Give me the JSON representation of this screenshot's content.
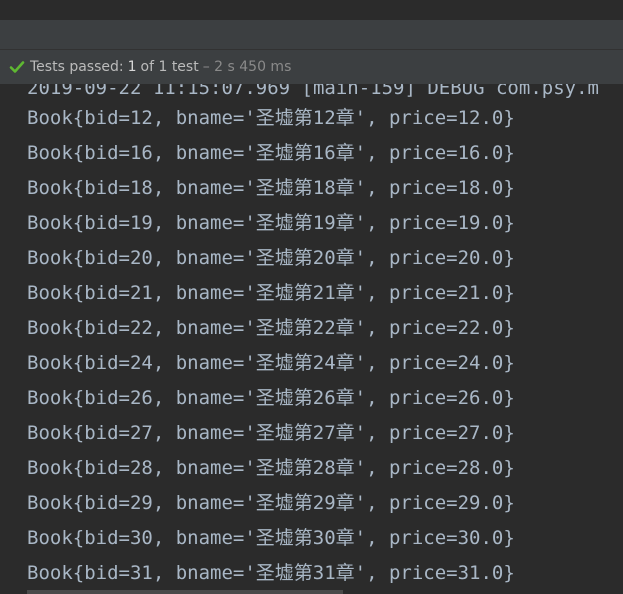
{
  "status": {
    "label": "Tests passed:",
    "passed": "1",
    "of_text": "of 1 test",
    "duration": "– 2 s 450 ms",
    "icon": "check-icon",
    "icon_color": "#5fb832"
  },
  "console": {
    "lines": [
      "2019-09-22 11:15:07.969 [main-159] DEBUG com.psy.m",
      "Book{bid=12, bname='圣墟第12章', price=12.0}",
      "Book{bid=16, bname='圣墟第16章', price=16.0}",
      "Book{bid=18, bname='圣墟第18章', price=18.0}",
      "Book{bid=19, bname='圣墟第19章', price=19.0}",
      "Book{bid=20, bname='圣墟第20章', price=20.0}",
      "Book{bid=21, bname='圣墟第21章', price=21.0}",
      "Book{bid=22, bname='圣墟第22章', price=22.0}",
      "Book{bid=24, bname='圣墟第24章', price=24.0}",
      "Book{bid=26, bname='圣墟第26章', price=26.0}",
      "Book{bid=27, bname='圣墟第27章', price=27.0}",
      "Book{bid=28, bname='圣墟第28章', price=28.0}",
      "Book{bid=29, bname='圣墟第29章', price=29.0}",
      "Book{bid=30, bname='圣墟第30章', price=30.0}",
      "Book{bid=31, bname='圣墟第31章', price=31.0}"
    ]
  },
  "colors": {
    "background": "#2b2b2b",
    "toolbar": "#3c3f41",
    "text": "#a9b7c6"
  }
}
